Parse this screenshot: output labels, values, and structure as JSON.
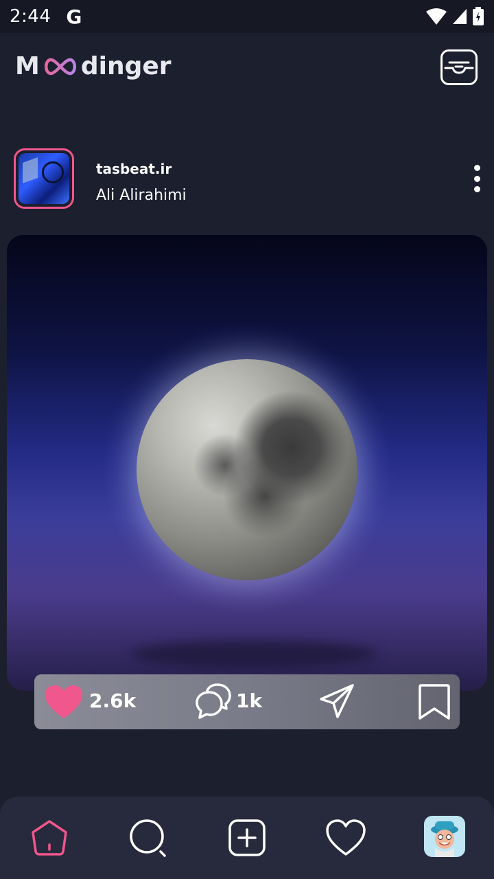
{
  "status_bar": {
    "time": "2:44",
    "carrier_icon": "G"
  },
  "app": {
    "logo_left": "M",
    "logo_right": "dinger",
    "logo_symbol": "infinity-icon",
    "accent_color": "#f0578c"
  },
  "post": {
    "username": "tasbeat.ir",
    "full_name": "Ali Alirahimi",
    "image_subject": "full moon",
    "likes": "2.6k",
    "comments": "1k"
  },
  "nav": {
    "items": [
      "home-icon",
      "search-icon",
      "add-icon",
      "heart-icon",
      "profile-avatar"
    ],
    "active": "home"
  }
}
